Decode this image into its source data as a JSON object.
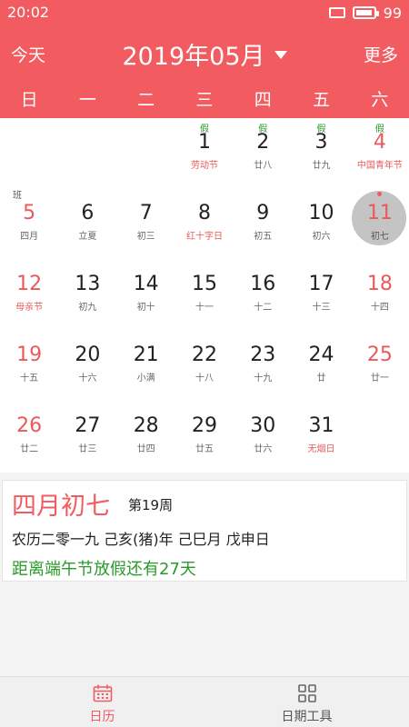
{
  "status": {
    "time": "20:02",
    "battery": "99",
    "battery_level": 0.99
  },
  "nav": {
    "today": "今天",
    "title": "2019年05月",
    "more": "更多"
  },
  "weekdays": [
    "日",
    "一",
    "二",
    "三",
    "四",
    "五",
    "六"
  ],
  "calendar": {
    "rows": [
      [
        {
          "day": "",
          "lunar": "",
          "badge": ""
        },
        {
          "day": "",
          "lunar": "",
          "badge": ""
        },
        {
          "day": "",
          "lunar": "",
          "badge": ""
        },
        {
          "day": "1",
          "lunar": "劳动节",
          "badge": "假"
        },
        {
          "day": "2",
          "lunar": "廿八",
          "badge": "假"
        },
        {
          "day": "3",
          "lunar": "廿九",
          "badge": "假"
        },
        {
          "day": "4",
          "lunar": "中国青年节",
          "badge": "假"
        }
      ],
      [
        {
          "day": "5",
          "lunar": "四月",
          "badge": "班"
        },
        {
          "day": "6",
          "lunar": "立夏",
          "badge": ""
        },
        {
          "day": "7",
          "lunar": "初三",
          "badge": ""
        },
        {
          "day": "8",
          "lunar": "红十字日",
          "badge": ""
        },
        {
          "day": "9",
          "lunar": "初五",
          "badge": ""
        },
        {
          "day": "10",
          "lunar": "初六",
          "badge": ""
        },
        {
          "day": "11",
          "lunar": "初七",
          "badge": ""
        }
      ],
      [
        {
          "day": "12",
          "lunar": "母亲节",
          "badge": ""
        },
        {
          "day": "13",
          "lunar": "初九",
          "badge": ""
        },
        {
          "day": "14",
          "lunar": "初十",
          "badge": ""
        },
        {
          "day": "15",
          "lunar": "十一",
          "badge": ""
        },
        {
          "day": "16",
          "lunar": "十二",
          "badge": ""
        },
        {
          "day": "17",
          "lunar": "十三",
          "badge": ""
        },
        {
          "day": "18",
          "lunar": "十四",
          "badge": ""
        }
      ],
      [
        {
          "day": "19",
          "lunar": "十五",
          "badge": ""
        },
        {
          "day": "20",
          "lunar": "十六",
          "badge": ""
        },
        {
          "day": "21",
          "lunar": "小满",
          "badge": ""
        },
        {
          "day": "22",
          "lunar": "十八",
          "badge": ""
        },
        {
          "day": "23",
          "lunar": "十九",
          "badge": ""
        },
        {
          "day": "24",
          "lunar": "廿",
          "badge": ""
        },
        {
          "day": "25",
          "lunar": "廿一",
          "badge": ""
        }
      ],
      [
        {
          "day": "26",
          "lunar": "廿二",
          "badge": ""
        },
        {
          "day": "27",
          "lunar": "廿三",
          "badge": ""
        },
        {
          "day": "28",
          "lunar": "廿四",
          "badge": ""
        },
        {
          "day": "29",
          "lunar": "廿五",
          "badge": ""
        },
        {
          "day": "30",
          "lunar": "廿六",
          "badge": ""
        },
        {
          "day": "31",
          "lunar": "无烟日",
          "badge": ""
        },
        {
          "day": "",
          "lunar": "",
          "badge": ""
        }
      ]
    ]
  },
  "info": {
    "lunar_date": "四月初七",
    "week": "第19周",
    "ganzhi": "农历二零一九 己亥(猪)年 己巳月 戊申日",
    "countdown": "距离端午节放假还有27天"
  },
  "tabs": {
    "calendar": "日历",
    "tools": "日期工具"
  },
  "colors": {
    "accent": "#f25b5f",
    "holiday_green": "#2a9a2a",
    "selected_gray": "#c4c4c4"
  }
}
